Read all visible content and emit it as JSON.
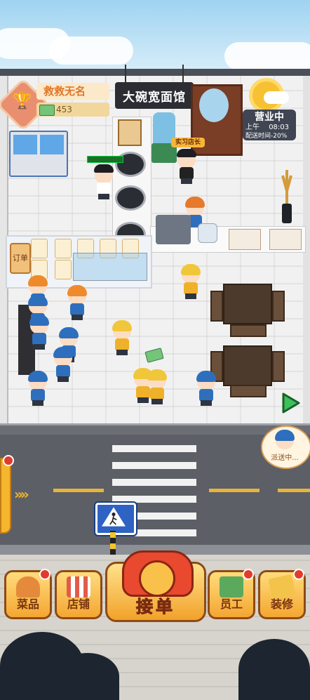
{
  "shop": {
    "name": "大碗宽面馆"
  },
  "player": {
    "name": "救救无名",
    "money": "453"
  },
  "status": {
    "label": "营业中",
    "period": "上午",
    "time": "08:03",
    "delivery_rate": "配送时间-20%"
  },
  "staff": {
    "intern_badge": "实习店长"
  },
  "counter": {
    "order_tag": "订单"
  },
  "delivery": {
    "bubble": "派送中..."
  },
  "bottom_menu": {
    "dishes": "菜品",
    "shop": "店铺",
    "accept_order": "接单",
    "staff": "员工",
    "decorate": "装修"
  },
  "icons": {
    "trophy": "trophy-icon",
    "cash": "cash-icon",
    "weather": "sun-cloud-icon",
    "phone": "telephone-icon",
    "crossing": "pedestrian-crossing-icon",
    "play": "play-icon"
  },
  "colors": {
    "accent": "#f4a632",
    "phone": "#e8492f",
    "notify": "#e23b2c"
  }
}
